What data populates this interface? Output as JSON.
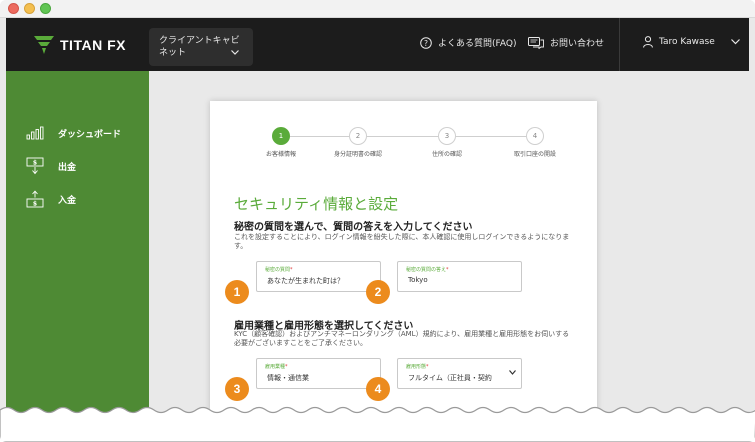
{
  "header": {
    "logo": "TITAN FX",
    "cabinet_label": "クライアントキャビネット",
    "faq_label": "よくある質問(FAQ)",
    "contact_label": "お問い合わせ",
    "user_name": "Taro Kawase"
  },
  "sidebar": {
    "items": [
      {
        "label": "ダッシュボード",
        "icon": "bar-chart-icon"
      },
      {
        "label": "出金",
        "icon": "withdraw-icon"
      },
      {
        "label": "入金",
        "icon": "deposit-icon"
      }
    ]
  },
  "stepper": {
    "steps": [
      {
        "number": "1",
        "label": "お客様情報",
        "active": true
      },
      {
        "number": "2",
        "label": "身分証明書の確認",
        "active": false
      },
      {
        "number": "3",
        "label": "住所の確認",
        "active": false
      },
      {
        "number": "4",
        "label": "取引口座の開設",
        "active": false
      }
    ]
  },
  "form": {
    "title": "セキュリティ情報と設定",
    "section1_heading": "秘密の質問を選んで、質問の答えを入力してください",
    "section1_desc": "これを設定することにより、ログイン情報を紛失した際に、本人確認に使用しログインできるようになります。",
    "secret_question_label": "秘密の質問",
    "secret_question_value": "あなたが生まれた町は？",
    "secret_answer_label": "秘密の質問の答え",
    "secret_answer_value": "Tokyo",
    "section2_heading": "雇用業種と雇用形態を選択してください",
    "section2_desc": "KYC（顧客確認）およびアンチマネーロンダリング（AML）規約により、雇用業種と雇用形態をお伺いする必要がございますことをご了承ください。",
    "industry_label": "雇用業種",
    "industry_value": "情報・通信業",
    "employment_label": "雇用形態",
    "employment_value": "フルタイム（正社員・契約",
    "required_mark": "*"
  },
  "badges": [
    "1",
    "2",
    "3",
    "4"
  ],
  "colors": {
    "brand_green": "#5aab3a",
    "sidebar_green": "#4e8a34",
    "topbar": "#1c1c1c",
    "badge_orange": "#ec8b1d"
  }
}
